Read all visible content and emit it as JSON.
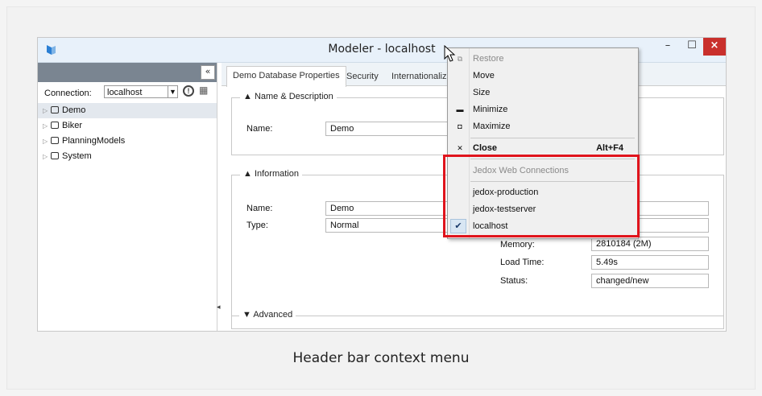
{
  "caption": "Header bar context menu",
  "window": {
    "title": "Modeler - localhost",
    "min_glyph": "–",
    "max_glyph": "☐",
    "close_glyph": "×"
  },
  "left_panel": {
    "collapse_glyph": "«",
    "connection_label": "Connection:",
    "connection_value": "localhost",
    "info_glyph": "!",
    "tree": [
      {
        "label": "Demo"
      },
      {
        "label": "Biker"
      },
      {
        "label": "PlanningModels"
      },
      {
        "label": "System"
      }
    ]
  },
  "tabs": [
    {
      "label": "Demo Database Properties"
    },
    {
      "label": "Security"
    },
    {
      "label": "Internationaliz"
    }
  ],
  "name_group": {
    "legend": "▲ Name & Description",
    "name_label": "Name:",
    "name_value": "Demo"
  },
  "info_group": {
    "legend": "▲ Information",
    "name_label": "Name:",
    "name_value": "Demo",
    "type_label": "Type:",
    "type_value": "Normal",
    "memory_label": "Memory:",
    "memory_value": "2810184 (2M)",
    "loadtime_label": "Load Time:",
    "loadtime_value": "5.49s",
    "status_label": "Status:",
    "status_value": "changed/new"
  },
  "advanced_legend": "▼ Advanced",
  "context_menu": {
    "items": [
      {
        "label": "Restore",
        "glyph": "⧉",
        "disabled": true
      },
      {
        "label": "Move",
        "glyph": ""
      },
      {
        "label": "Size",
        "glyph": ""
      },
      {
        "label": "Minimize",
        "glyph": "▬"
      },
      {
        "label": "Maximize",
        "glyph": "◘"
      },
      {
        "label": "Close",
        "glyph": "✕",
        "shortcut": "Alt+F4"
      }
    ],
    "section_header": "Jedox Web Connections",
    "connections": [
      {
        "label": "jedox-production"
      },
      {
        "label": "jedox-testserver"
      },
      {
        "label": "localhost",
        "checked": true,
        "check_glyph": "✔"
      }
    ],
    "highlight_color": "#e0141c"
  }
}
